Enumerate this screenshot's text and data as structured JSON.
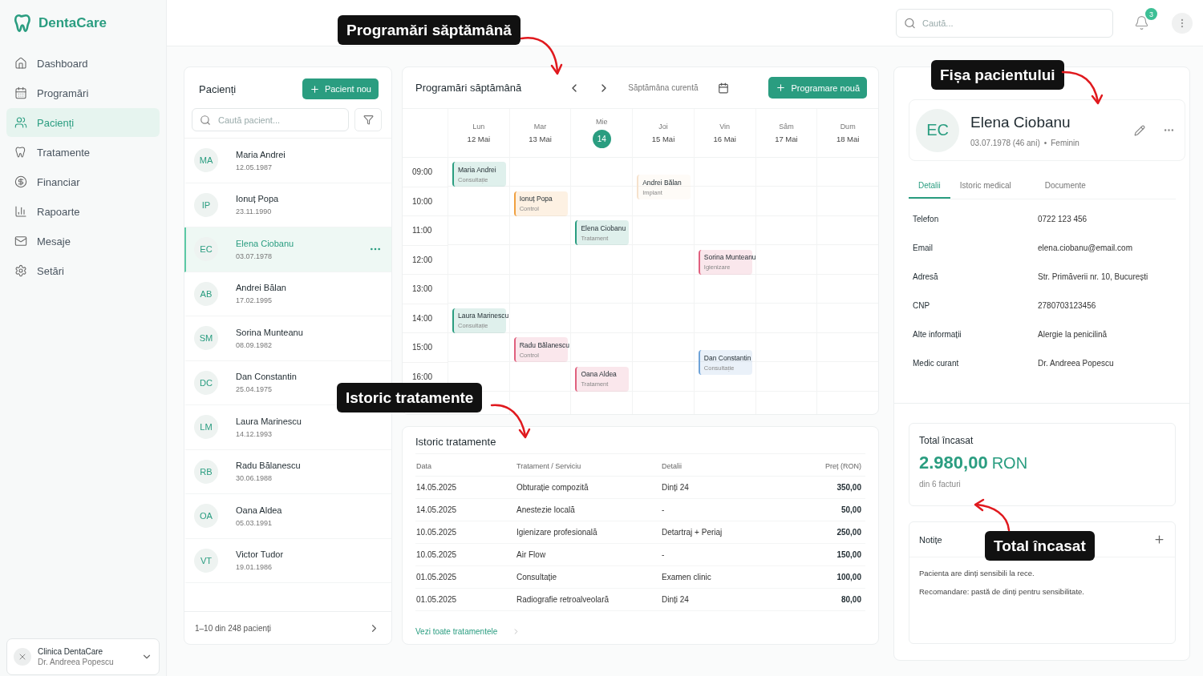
{
  "app": {
    "name": "DentaCare"
  },
  "sidebar": {
    "items": [
      {
        "label": "Dashboard",
        "selected": false
      },
      {
        "label": "Programări",
        "selected": false
      },
      {
        "label": "Pacienți",
        "selected": true
      },
      {
        "label": "Tratamente",
        "selected": false
      },
      {
        "label": "Financiar",
        "selected": false
      },
      {
        "label": "Rapoarte",
        "selected": false
      },
      {
        "label": "Mesaje",
        "selected": false
      },
      {
        "label": "Setări",
        "selected": false
      }
    ],
    "clinic": {
      "name": "Clinica DentaCare",
      "doctor": "Dr. Andreea Popescu"
    }
  },
  "topbar": {
    "search": {
      "placeholder": "Caută..."
    },
    "notifications": "3"
  },
  "patients": {
    "title": "Pacienți",
    "new_button": "Pacient nou",
    "search": {
      "placeholder": "Caută pacient..."
    },
    "items": [
      {
        "initials": "MA",
        "name": "Maria Andrei",
        "birthdate": "12.05.1987",
        "selected": false
      },
      {
        "initials": "IP",
        "name": "Ionuț Popa",
        "birthdate": "23.11.1990",
        "selected": false
      },
      {
        "initials": "EC",
        "name": "Elena Ciobanu",
        "birthdate": "03.07.1978",
        "selected": true
      },
      {
        "initials": "AB",
        "name": "Andrei Bălan",
        "birthdate": "17.02.1995",
        "selected": false
      },
      {
        "initials": "SM",
        "name": "Sorina Munteanu",
        "birthdate": "08.09.1982",
        "selected": false
      },
      {
        "initials": "DC",
        "name": "Dan Constantin",
        "birthdate": "25.04.1975",
        "selected": false
      },
      {
        "initials": "LM",
        "name": "Laura Marinescu",
        "birthdate": "14.12.1993",
        "selected": false
      },
      {
        "initials": "RB",
        "name": "Radu Bălanescu",
        "birthdate": "30.06.1988",
        "selected": false
      },
      {
        "initials": "OA",
        "name": "Oana Aldea",
        "birthdate": "05.03.1991",
        "selected": false
      },
      {
        "initials": "VT",
        "name": "Victor Tudor",
        "birthdate": "19.01.1986",
        "selected": false
      }
    ],
    "footer": "1–10 din 248 pacienți"
  },
  "schedule": {
    "title": "Programări săptămână",
    "week_label": "Săptămâna curentă",
    "new_button": "Programare nouă",
    "hours": [
      "09:00",
      "10:00",
      "11:00",
      "12:00",
      "13:00",
      "14:00",
      "15:00",
      "16:00"
    ],
    "days": [
      {
        "name": "Lun",
        "date": "12 Mai",
        "today": false,
        "slots": [
          {
            "kind": "appointment",
            "patient": "Maria Andrei",
            "service": "Consultație",
            "color": "#2a9d80",
            "late": false
          },
          {
            "kind": "free"
          },
          {
            "kind": "free"
          },
          {
            "kind": "free"
          },
          {
            "kind": "free"
          },
          {
            "kind": "appointment",
            "patient": "Laura Marinescu",
            "service": "Consultație",
            "color": "#2a9d80",
            "late": false
          }
        ]
      },
      {
        "name": "Mar",
        "date": "13 Mai",
        "today": false,
        "slots": [
          {
            "kind": "free"
          },
          {
            "kind": "appointment",
            "patient": "Ionuț Popa",
            "service": "Control",
            "color": "#f0a040",
            "late": false
          },
          {
            "kind": "free"
          },
          {
            "kind": "free"
          },
          {
            "kind": "free"
          },
          {
            "kind": "free"
          },
          {
            "kind": "appointment",
            "patient": "Radu Bălanescu",
            "service": "Control",
            "color": "#e0607e",
            "late": false
          }
        ]
      },
      {
        "name": "Mie",
        "date": "14",
        "today": true,
        "slots": [
          {
            "kind": "free"
          },
          {
            "kind": "free"
          },
          {
            "kind": "appointment",
            "patient": "Elena Ciobanu",
            "service": "Tratament",
            "color": "#2a9d80",
            "late": false
          },
          {
            "kind": "free"
          },
          {
            "kind": "free"
          },
          {
            "kind": "free"
          },
          {
            "kind": "free"
          },
          {
            "kind": "appointment",
            "patient": "Oana Aldea",
            "service": "Tratament",
            "color": "#e0607e",
            "late": false
          }
        ]
      },
      {
        "name": "Joi",
        "date": "15 Mai",
        "today": false,
        "slots": [
          {
            "kind": "appointment",
            "patient": "Andrei Bălan",
            "service": "Implant",
            "color": "#f6e2cc",
            "late": true
          }
        ]
      },
      {
        "name": "Vin",
        "date": "16 Mai",
        "today": false,
        "slots": [
          {
            "kind": "free"
          },
          {
            "kind": "free"
          },
          {
            "kind": "free"
          },
          {
            "kind": "appointment",
            "patient": "Sorina Munteanu",
            "service": "Igienizare",
            "color": "#e0607e",
            "late": false
          },
          {
            "kind": "free"
          },
          {
            "kind": "free"
          },
          {
            "kind": "appointment",
            "patient": "Dan Constantin",
            "service": "Consultație",
            "color": "#6fa3d8",
            "late": true
          }
        ]
      },
      {
        "name": "Sâm",
        "date": "17 Mai",
        "today": false
      },
      {
        "name": "Dum",
        "date": "18 Mai",
        "today": false
      }
    ]
  },
  "history": {
    "title": "Istoric tratamente",
    "columns": [
      "Data",
      "Tratament / Serviciu",
      "Detalii",
      "Preț (RON)"
    ],
    "rows": [
      [
        "14.05.2025",
        "Obturație compozită",
        "Dinți 24",
        "350,00"
      ],
      [
        "14.05.2025",
        "Anestezie locală",
        "-",
        "50,00"
      ],
      [
        "10.05.2025",
        "Igienizare profesională",
        "Detartraj + Periaj",
        "250,00"
      ],
      [
        "10.05.2025",
        "Air Flow",
        "-",
        "150,00"
      ],
      [
        "01.05.2025",
        "Consultație",
        "Examen clinic",
        "100,00"
      ],
      [
        "01.05.2025",
        "Radiografie retroalveolară",
        "Dinți 24",
        "80,00"
      ]
    ],
    "link": "Vezi toate tratamentele"
  },
  "patient_card": {
    "initials": "EC",
    "name": "Elena Ciobanu",
    "birth": "03.07.1978 (46 ani)",
    "separator": "•",
    "gender": "Feminin",
    "tabs": [
      {
        "label": "Detalii",
        "selected": true
      },
      {
        "label": "Istoric medical",
        "selected": false
      },
      {
        "label": "Documente",
        "selected": false
      }
    ],
    "details": [
      {
        "label": "Telefon",
        "value": "0722 123 456"
      },
      {
        "label": "Email",
        "value": "elena.ciobanu@email.com"
      },
      {
        "label": "Adresă",
        "value": "Str. Primăverii nr. 10, București"
      },
      {
        "label": "CNP",
        "value": "2780703123456"
      },
      {
        "label": "Alte informații",
        "value": "Alergie la penicilină"
      },
      {
        "label": "Medic curant",
        "value": "Dr. Andreea Popescu"
      }
    ]
  },
  "total": {
    "label": "Total încasat",
    "amount": "2.980,00",
    "currency": "RON",
    "note": "din 6 facturi"
  },
  "notes": {
    "title": "Notițe",
    "lines": [
      "Pacienta are dinți sensibili la rece.",
      "Recomandare: pastă de dinți pentru sensibilitate."
    ]
  },
  "callouts": [
    {
      "text": "Programări săptămână"
    },
    {
      "text": "Istoric tratamente"
    },
    {
      "text": "Fișa pacientului"
    },
    {
      "text": "Total încasat"
    }
  ]
}
